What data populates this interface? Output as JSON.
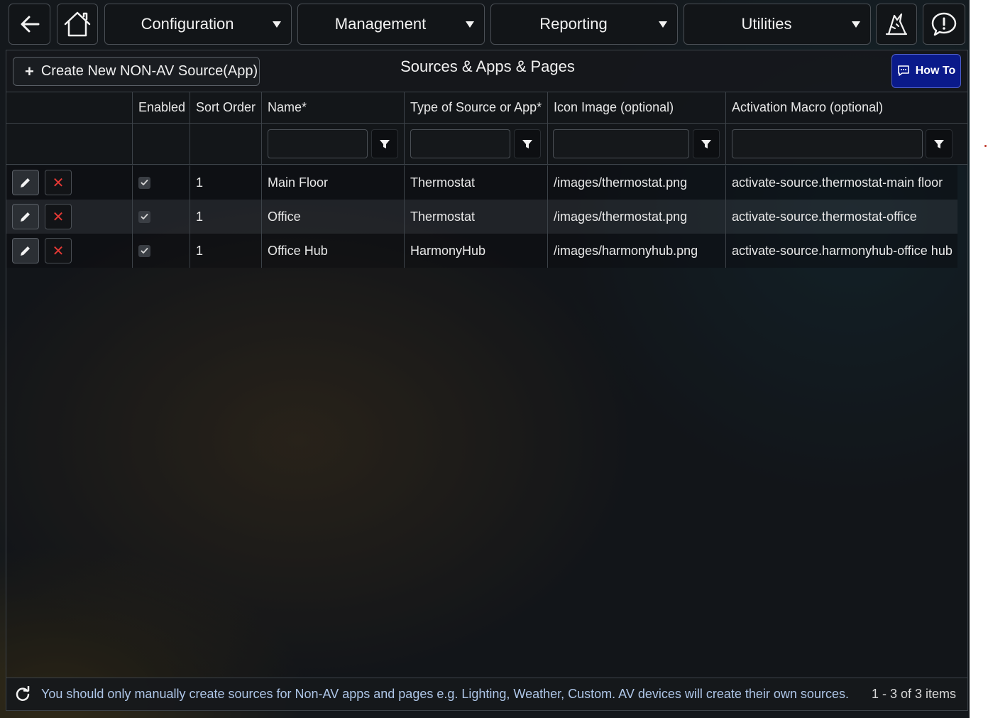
{
  "nav": {
    "menus": [
      {
        "label": "Configuration"
      },
      {
        "label": "Management"
      },
      {
        "label": "Reporting"
      },
      {
        "label": "Utilities"
      }
    ]
  },
  "toolbar": {
    "create_label": "Create New NON-AV Source(App)",
    "title": "Sources & Apps & Pages",
    "howto_label": "How To"
  },
  "grid": {
    "columns": [
      "",
      "Enabled",
      "Sort Order",
      "Name*",
      "Type of Source or App*",
      "Icon Image (optional)",
      "Activation Macro (optional)"
    ],
    "rows": [
      {
        "enabled": true,
        "sort_order": "1",
        "name": "Main Floor",
        "type": "Thermostat",
        "icon": "/images/thermostat.png",
        "macro": "activate-source.thermostat-main floor"
      },
      {
        "enabled": true,
        "sort_order": "1",
        "name": "Office",
        "type": "Thermostat",
        "icon": "/images/thermostat.png",
        "macro": "activate-source.thermostat-office"
      },
      {
        "enabled": true,
        "sort_order": "1",
        "name": "Office Hub",
        "type": "HarmonyHub",
        "icon": "/images/harmonyhub.png",
        "macro": "activate-source.harmonyhub-office hub"
      }
    ]
  },
  "footer": {
    "message": "You should only manually create sources for Non-AV apps and pages e.g. Lighting, Weather, Custom. AV devices will create their own sources.",
    "count": "1 - 3 of 3 items"
  },
  "colors": {
    "accent_button": "#0a1a8a",
    "delete_icon": "#e53935",
    "footer_text": "#aec6e8"
  }
}
